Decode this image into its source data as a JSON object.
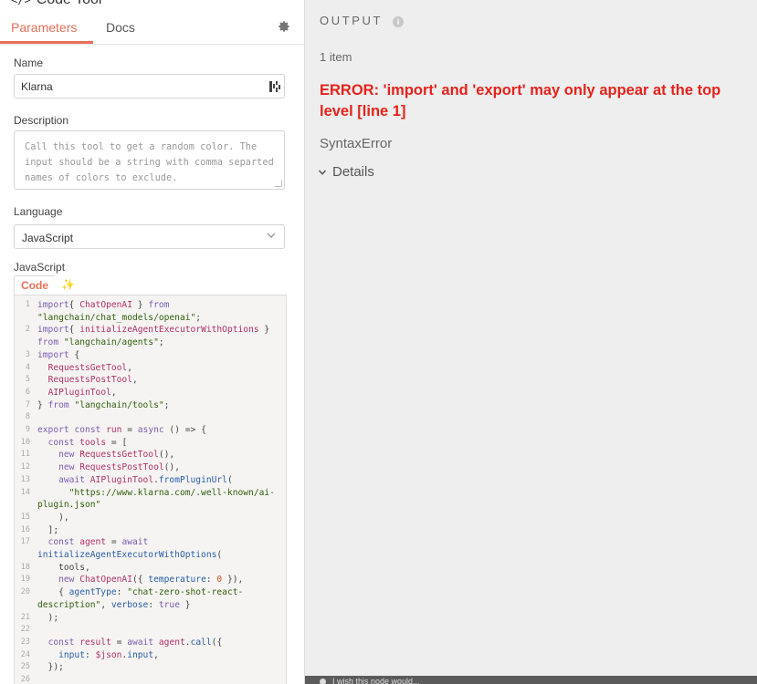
{
  "header": {
    "title": "Code Tool",
    "title_icon": "code-icon"
  },
  "tabs": [
    {
      "label": "Parameters",
      "active": true
    },
    {
      "label": "Docs",
      "active": false
    }
  ],
  "form": {
    "name_label": "Name",
    "name_value": "Klarna",
    "description_label": "Description",
    "description_value": "Call this tool to get a random color. The input should be a string with comma separted names of colors to exclude.",
    "language_label": "Language",
    "language_value": "JavaScript",
    "code_label": "JavaScript",
    "code_tabs": [
      "Code",
      "✨ Ask AI"
    ]
  },
  "code_lines": [
    {
      "n": "1",
      "parts": [
        [
          "kw",
          "import"
        ],
        [
          "",
          "{ "
        ],
        [
          "fn",
          "ChatOpenAI"
        ],
        [
          "",
          " } "
        ],
        [
          "kw",
          "from"
        ]
      ]
    },
    {
      "n": "",
      "parts": [
        [
          "st",
          "\"langchain/chat_models/openai\""
        ],
        [
          "",
          ";"
        ]
      ]
    },
    {
      "n": "2",
      "parts": [
        [
          "kw",
          "import"
        ],
        [
          "",
          "{ "
        ],
        [
          "fn",
          "initializeAgentExecutorWithOptions"
        ],
        [
          "",
          " }"
        ]
      ]
    },
    {
      "n": "",
      "parts": [
        [
          "kw",
          "from"
        ],
        [
          "",
          " "
        ],
        [
          "st",
          "\"langchain/agents\""
        ],
        [
          "",
          ";"
        ]
      ]
    },
    {
      "n": "3",
      "parts": [
        [
          "kw",
          "import"
        ],
        [
          "",
          " {"
        ]
      ]
    },
    {
      "n": "4",
      "parts": [
        [
          "",
          "  "
        ],
        [
          "fn",
          "RequestsGetTool"
        ],
        [
          "",
          ","
        ]
      ]
    },
    {
      "n": "5",
      "parts": [
        [
          "",
          "  "
        ],
        [
          "fn",
          "RequestsPostTool"
        ],
        [
          "",
          ","
        ]
      ]
    },
    {
      "n": "6",
      "parts": [
        [
          "",
          "  "
        ],
        [
          "fn",
          "AIPluginTool"
        ],
        [
          "",
          ","
        ]
      ]
    },
    {
      "n": "7",
      "parts": [
        [
          "",
          "} "
        ],
        [
          "kw",
          "from"
        ],
        [
          "",
          " "
        ],
        [
          "st",
          "\"langchain/tools\""
        ],
        [
          "",
          ";"
        ]
      ]
    },
    {
      "n": "8",
      "parts": []
    },
    {
      "n": "9",
      "parts": [
        [
          "kw",
          "export"
        ],
        [
          "",
          " "
        ],
        [
          "kw",
          "const"
        ],
        [
          "",
          " "
        ],
        [
          "fn",
          "run"
        ],
        [
          "",
          " = "
        ],
        [
          "kw",
          "async"
        ],
        [
          "",
          " () => {"
        ]
      ]
    },
    {
      "n": "10",
      "parts": [
        [
          "",
          "  "
        ],
        [
          "kw",
          "const"
        ],
        [
          "",
          " "
        ],
        [
          "fn",
          "tools"
        ],
        [
          "",
          " = ["
        ]
      ]
    },
    {
      "n": "11",
      "parts": [
        [
          "",
          "    "
        ],
        [
          "kw",
          "new"
        ],
        [
          "",
          " "
        ],
        [
          "fn",
          "RequestsGetTool"
        ],
        [
          "",
          "(),"
        ]
      ]
    },
    {
      "n": "12",
      "parts": [
        [
          "",
          "    "
        ],
        [
          "kw",
          "new"
        ],
        [
          "",
          " "
        ],
        [
          "fn",
          "RequestsPostTool"
        ],
        [
          "",
          "(),"
        ]
      ]
    },
    {
      "n": "13",
      "parts": [
        [
          "",
          "    "
        ],
        [
          "kw",
          "await"
        ],
        [
          "",
          " "
        ],
        [
          "fn",
          "AIPluginTool"
        ],
        [
          "",
          "."
        ],
        [
          "pr",
          "fromPluginUrl"
        ],
        [
          "",
          "("
        ]
      ]
    },
    {
      "n": "14",
      "parts": [
        [
          "",
          "      "
        ],
        [
          "st",
          "\"https://www.klarna.com/.well-known/ai-"
        ]
      ]
    },
    {
      "n": "",
      "parts": [
        [
          "st",
          "plugin.json\""
        ]
      ]
    },
    {
      "n": "15",
      "parts": [
        [
          "",
          "    ),"
        ]
      ]
    },
    {
      "n": "16",
      "parts": [
        [
          "",
          "  ];"
        ]
      ]
    },
    {
      "n": "17",
      "parts": [
        [
          "",
          "  "
        ],
        [
          "kw",
          "const"
        ],
        [
          "",
          " "
        ],
        [
          "fn",
          "agent"
        ],
        [
          "",
          " = "
        ],
        [
          "kw",
          "await"
        ]
      ]
    },
    {
      "n": "",
      "parts": [
        [
          "pr",
          "initializeAgentExecutorWithOptions"
        ],
        [
          "",
          "("
        ]
      ]
    },
    {
      "n": "18",
      "parts": [
        [
          "",
          "    tools,"
        ]
      ]
    },
    {
      "n": "19",
      "parts": [
        [
          "",
          "    "
        ],
        [
          "kw",
          "new"
        ],
        [
          "",
          " "
        ],
        [
          "fn",
          "ChatOpenAI"
        ],
        [
          "",
          "({ "
        ],
        [
          "pr",
          "temperature"
        ],
        [
          "",
          ": "
        ],
        [
          "nm",
          "0"
        ],
        [
          "",
          " }),"
        ]
      ]
    },
    {
      "n": "20",
      "parts": [
        [
          "",
          "    { "
        ],
        [
          "pr",
          "agentType"
        ],
        [
          "",
          ": "
        ],
        [
          "st",
          "\"chat-zero-shot-react-"
        ]
      ]
    },
    {
      "n": "",
      "parts": [
        [
          "st",
          "description\""
        ],
        [
          "",
          ", "
        ],
        [
          "pr",
          "verbose"
        ],
        [
          "",
          ": "
        ],
        [
          "kw",
          "true"
        ],
        [
          "",
          " }"
        ]
      ]
    },
    {
      "n": "21",
      "parts": [
        [
          "",
          "  );"
        ]
      ]
    },
    {
      "n": "22",
      "parts": []
    },
    {
      "n": "23",
      "parts": [
        [
          "",
          "  "
        ],
        [
          "kw",
          "const"
        ],
        [
          "",
          " "
        ],
        [
          "fn",
          "result"
        ],
        [
          "",
          " = "
        ],
        [
          "kw",
          "await"
        ],
        [
          "",
          " "
        ],
        [
          "fn",
          "agent"
        ],
        [
          "",
          "."
        ],
        [
          "pr",
          "call"
        ],
        [
          "",
          "({"
        ]
      ]
    },
    {
      "n": "24",
      "parts": [
        [
          "",
          "    "
        ],
        [
          "pr",
          "input"
        ],
        [
          "",
          ": "
        ],
        [
          "fn",
          "$json"
        ],
        [
          "",
          "."
        ],
        [
          "pr",
          "input"
        ],
        [
          "",
          ","
        ]
      ]
    },
    {
      "n": "25",
      "parts": [
        [
          "",
          "  });"
        ]
      ]
    },
    {
      "n": "26",
      "parts": []
    }
  ],
  "output": {
    "title": "OUTPUT",
    "count": "1 item",
    "error_message": "ERROR: 'import' and 'export' may only appear at the top level [line 1]",
    "error_type": "SyntaxError",
    "details_label": "Details",
    "footer_text": "I wish this node would..."
  },
  "colors": {
    "accent": "#e8705a",
    "error": "#e5231b"
  }
}
